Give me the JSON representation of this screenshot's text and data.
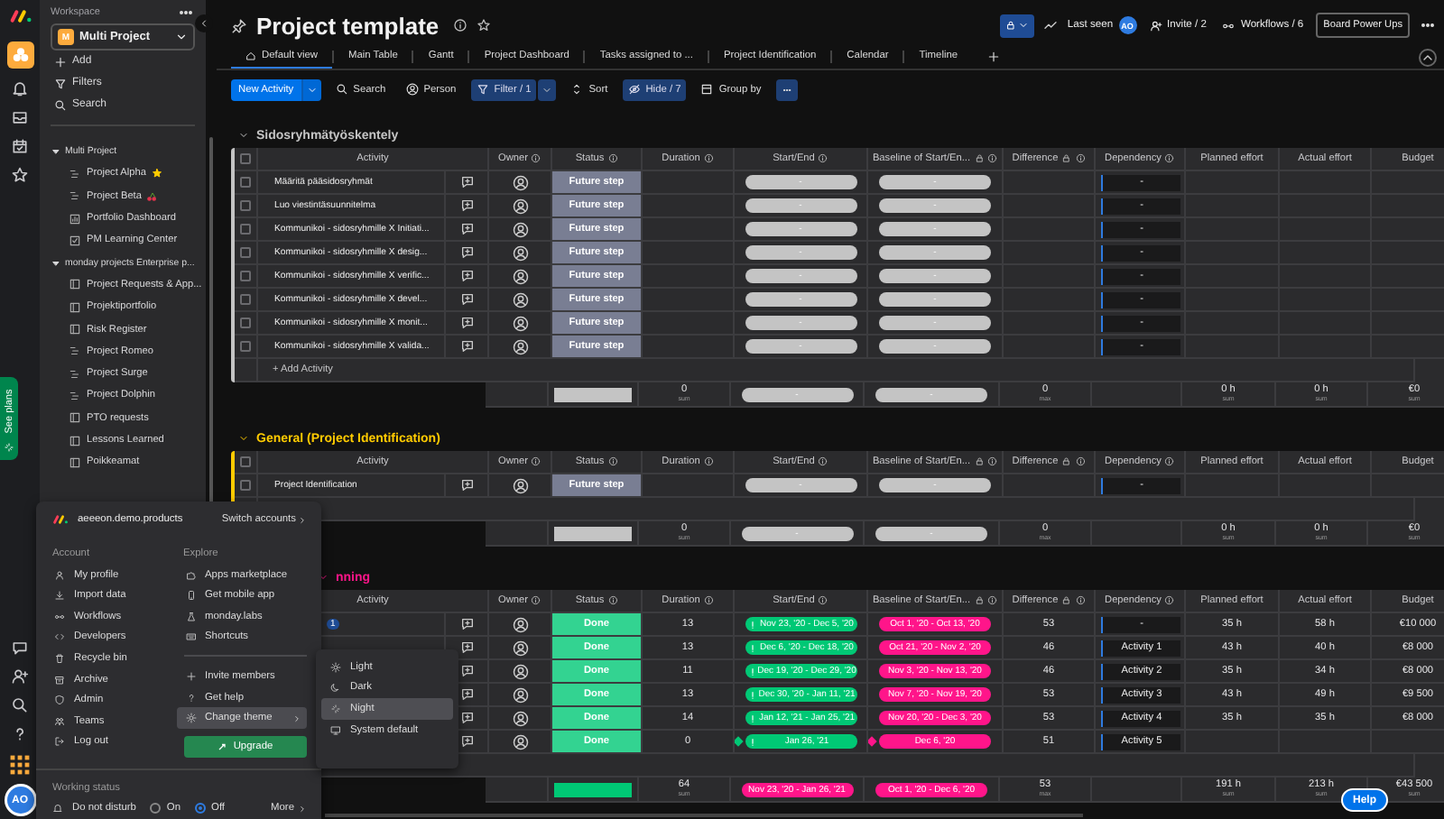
{
  "rail": {
    "user_initials": "AO"
  },
  "sidebar": {
    "workspace_label": "Workspace",
    "workspace_badge": "M",
    "workspace": "Multi Project",
    "actions": [
      "Add",
      "Filters",
      "Search"
    ],
    "tree": [
      {
        "label": "Multi Project",
        "expanded": true,
        "children": [
          {
            "label": "Project Alpha",
            "kind": "gantt",
            "decoration": {
              "kind": "sparkle"
            }
          },
          {
            "label": "Project Beta",
            "kind": "gantt",
            "decoration": {
              "kind": "cherries"
            }
          },
          {
            "label": "Portfolio Dashboard",
            "kind": "dashboard"
          },
          {
            "label": "PM Learning Center",
            "kind": "doc"
          }
        ]
      },
      {
        "label": "monday projects Enterprise p...",
        "expanded": true,
        "children": [
          {
            "label": "Project Requests & App...",
            "kind": "board"
          },
          {
            "label": "Projektiportfolio",
            "kind": "board"
          },
          {
            "label": "Risk Register",
            "kind": "board"
          },
          {
            "label": "Project Romeo",
            "kind": "gantt"
          },
          {
            "label": "Project Surge",
            "kind": "gantt"
          },
          {
            "label": "Project Dolphin",
            "kind": "gantt"
          },
          {
            "label": "PTO requests",
            "kind": "board"
          },
          {
            "label": "Lessons Learned",
            "kind": "board"
          },
          {
            "label": "Poikkeamat",
            "kind": "board"
          }
        ]
      }
    ],
    "see_plans": "See plans"
  },
  "header": {
    "title": "Project template",
    "last_seen": "Last seen",
    "avatar": "AO",
    "invite": "Invite / 2",
    "workflows": "Workflows / 6",
    "power_ups": "Board Power Ups"
  },
  "tabs": [
    {
      "label": "Default view",
      "selected": true
    },
    {
      "label": "Main Table",
      "selected": false
    },
    {
      "label": "Gantt",
      "selected": false
    },
    {
      "label": "Project Dashboard",
      "selected": false
    },
    {
      "label": "Tasks assigned to ...",
      "selected": false
    },
    {
      "label": "Project Identification",
      "selected": false
    },
    {
      "label": "Calendar",
      "selected": false
    },
    {
      "label": "Timeline",
      "selected": false
    }
  ],
  "toolbar": {
    "new_item": "New Activity",
    "search": "Search",
    "person": "Person",
    "filter": "Filter / 1",
    "sort": "Sort",
    "hide": "Hide / 7",
    "group_by": "Group by"
  },
  "groups": [
    {
      "title": "Sidosryhmätyöskentely",
      "color": "#c4c4c4",
      "select_all": false,
      "add_label": "+ Add Activity",
      "columns": [
        {
          "label": "Activity"
        },
        {
          "label": "Owner",
          "info": true
        },
        {
          "label": "Status",
          "info": true
        },
        {
          "label": "Duration",
          "info": true
        },
        {
          "label": "Start/End",
          "info": true
        },
        {
          "label": "Baseline of Start/En...",
          "locked": true,
          "info": true
        },
        {
          "label": "Difference",
          "locked": true,
          "info": true
        },
        {
          "label": "Dependency",
          "info": true
        },
        {
          "label": "Planned effort"
        },
        {
          "label": "Actual effort"
        },
        {
          "label": "Budget"
        }
      ],
      "rows": [
        {
          "name": "Määritä pääsidosryhmät",
          "checked": false,
          "status": {
            "label": "Future step",
            "color": "#797e93"
          },
          "duration": "",
          "start_end": {
            "text": "-",
            "color": "#c4c4c4"
          },
          "baseline": {
            "text": "-",
            "color": "#c4c4c4"
          },
          "difference": "",
          "dependency": "-",
          "planned": "",
          "actual": "",
          "budget": ""
        },
        {
          "name": "Luo viestintäsuunnitelma",
          "checked": false,
          "status": {
            "label": "Future step",
            "color": "#797e93"
          },
          "duration": "",
          "start_end": {
            "text": "-",
            "color": "#c4c4c4"
          },
          "baseline": {
            "text": "-",
            "color": "#c4c4c4"
          },
          "difference": "",
          "dependency": "-",
          "planned": "",
          "actual": "",
          "budget": ""
        },
        {
          "name": "Kommunikoi - sidosryhmille X Initiati...",
          "checked": false,
          "status": {
            "label": "Future step",
            "color": "#797e93"
          },
          "duration": "",
          "start_end": {
            "text": "-",
            "color": "#c4c4c4"
          },
          "baseline": {
            "text": "-",
            "color": "#c4c4c4"
          },
          "difference": "",
          "dependency": "-",
          "planned": "",
          "actual": "",
          "budget": ""
        },
        {
          "name": "Kommunikoi - sidosryhmille X desig...",
          "checked": false,
          "status": {
            "label": "Future step",
            "color": "#797e93"
          },
          "duration": "",
          "start_end": {
            "text": "-",
            "color": "#c4c4c4"
          },
          "baseline": {
            "text": "-",
            "color": "#c4c4c4"
          },
          "difference": "",
          "dependency": "-",
          "planned": "",
          "actual": "",
          "budget": ""
        },
        {
          "name": "Kommunikoi - sidosryhmille X verific...",
          "checked": false,
          "status": {
            "label": "Future step",
            "color": "#797e93"
          },
          "duration": "",
          "start_end": {
            "text": "-",
            "color": "#c4c4c4"
          },
          "baseline": {
            "text": "-",
            "color": "#c4c4c4"
          },
          "difference": "",
          "dependency": "-",
          "planned": "",
          "actual": "",
          "budget": ""
        },
        {
          "name": "Kommunikoi - sidosryhmille X devel...",
          "checked": false,
          "status": {
            "label": "Future step",
            "color": "#797e93"
          },
          "duration": "",
          "start_end": {
            "text": "-",
            "color": "#c4c4c4"
          },
          "baseline": {
            "text": "-",
            "color": "#c4c4c4"
          },
          "difference": "",
          "dependency": "-",
          "planned": "",
          "actual": "",
          "budget": ""
        },
        {
          "name": "Kommunikoi - sidosryhmille X monit...",
          "checked": false,
          "status": {
            "label": "Future step",
            "color": "#797e93"
          },
          "duration": "",
          "start_end": {
            "text": "-",
            "color": "#c4c4c4"
          },
          "baseline": {
            "text": "-",
            "color": "#c4c4c4"
          },
          "difference": "",
          "dependency": "-",
          "planned": "",
          "actual": "",
          "budget": ""
        },
        {
          "name": "Kommunikoi - sidosryhmille X valida...",
          "checked": false,
          "status": {
            "label": "Future step",
            "color": "#797e93"
          },
          "duration": "",
          "start_end": {
            "text": "-",
            "color": "#c4c4c4"
          },
          "baseline": {
            "text": "-",
            "color": "#c4c4c4"
          },
          "difference": "",
          "dependency": "-",
          "planned": "",
          "actual": "",
          "budget": ""
        }
      ],
      "summary": {
        "status_bar": {
          "color": "#c4c4c4"
        },
        "duration": "0",
        "duration_fn": "sum",
        "start_end": {
          "text": "-",
          "color": "#c4c4c4"
        },
        "baseline": {
          "text": "-",
          "color": "#c4c4c4"
        },
        "difference": "0",
        "difference_fn": "max",
        "planned": "0 h",
        "planned_fn": "sum",
        "actual": "0 h",
        "actual_fn": "sum",
        "budget": "€0",
        "budget_fn": "sum"
      }
    },
    {
      "title": "General (Project Identification)",
      "color": "#ffcb00",
      "select_all": false,
      "columns": [
        {
          "label": "Activity"
        },
        {
          "label": "Owner",
          "info": true
        },
        {
          "label": "Status",
          "info": true
        },
        {
          "label": "Duration",
          "info": true
        },
        {
          "label": "Start/End",
          "info": true
        },
        {
          "label": "Baseline of Start/En...",
          "locked": true,
          "info": true
        },
        {
          "label": "Difference",
          "locked": true,
          "info": true
        },
        {
          "label": "Dependency",
          "info": true
        },
        {
          "label": "Planned effort"
        },
        {
          "label": "Actual effort"
        },
        {
          "label": "Budget"
        }
      ],
      "rows": [
        {
          "name": "Project Identification",
          "checked": false,
          "status": {
            "label": "Future step",
            "color": "#797e93"
          },
          "duration": "",
          "start_end": {
            "text": "-",
            "color": "#c4c4c4"
          },
          "baseline": {
            "text": "-",
            "color": "#c4c4c4"
          },
          "difference": "",
          "dependency": "-",
          "planned": "",
          "actual": "",
          "budget": ""
        }
      ],
      "summary": {
        "status_bar": {
          "color": "#c4c4c4"
        },
        "duration": "0",
        "duration_fn": "sum",
        "start_end": {
          "text": "-",
          "color": "#c4c4c4"
        },
        "baseline": {
          "text": "-",
          "color": "#c4c4c4"
        },
        "difference": "0",
        "difference_fn": "max",
        "planned": "0 h",
        "planned_fn": "sum",
        "actual": "0 h",
        "actual_fn": "sum",
        "budget": "€0",
        "budget_fn": "sum"
      }
    },
    {
      "title": "nning",
      "color": "#ff158a",
      "columns": [
        {
          "label": "Activity"
        },
        {
          "label": "Owner",
          "info": true
        },
        {
          "label": "Status",
          "info": true
        },
        {
          "label": "Duration",
          "info": true
        },
        {
          "label": "Start/End",
          "info": true
        },
        {
          "label": "Baseline of Start/En...",
          "locked": true,
          "info": true
        },
        {
          "label": "Difference",
          "locked": true,
          "info": true
        },
        {
          "label": "Dependency",
          "info": true
        },
        {
          "label": "Planned effort"
        },
        {
          "label": "Actual effort"
        },
        {
          "label": "Budget"
        }
      ],
      "rows": [
        {
          "badge": "1",
          "status": {
            "label": "Done",
            "color": "#33d391"
          },
          "duration": "13",
          "start_end": {
            "text": "Nov 23, '20 - Dec 5, '20",
            "color": "#00c875",
            "alert": true
          },
          "baseline": {
            "text": "Oct 1, '20 - Oct 13, '20",
            "color": "#ff158a"
          },
          "difference": "53",
          "dependency": "-",
          "planned": "35 h",
          "actual": "58 h",
          "budget": "€10 000"
        },
        {
          "status": {
            "label": "Done",
            "color": "#33d391"
          },
          "duration": "13",
          "start_end": {
            "text": "Dec 6, '20 - Dec 18, '20",
            "color": "#00c875",
            "alert": true
          },
          "baseline": {
            "text": "Oct 21, '20 - Nov 2, '20",
            "color": "#ff158a"
          },
          "difference": "46",
          "dependency": "Activity 1",
          "planned": "43 h",
          "actual": "40 h",
          "budget": "€8 000"
        },
        {
          "status": {
            "label": "Done",
            "color": "#33d391"
          },
          "duration": "11",
          "start_end": {
            "text": "Dec 19, '20 - Dec 29, '20",
            "color": "#00c875",
            "alert": true
          },
          "baseline": {
            "text": "Nov 3, '20 - Nov 13, '20",
            "color": "#ff158a"
          },
          "difference": "46",
          "dependency": "Activity 2",
          "planned": "35 h",
          "actual": "34 h",
          "budget": "€8 000"
        },
        {
          "status": {
            "label": "Done",
            "color": "#33d391"
          },
          "duration": "13",
          "start_end": {
            "text": "Dec 30, '20 - Jan 11, '21",
            "color": "#00c875",
            "alert": true
          },
          "baseline": {
            "text": "Nov 7, '20 - Nov 19, '20",
            "color": "#ff158a"
          },
          "difference": "53",
          "dependency": "Activity 3",
          "planned": "43 h",
          "actual": "49 h",
          "budget": "€9 500"
        },
        {
          "status": {
            "label": "Done",
            "color": "#33d391"
          },
          "duration": "14",
          "start_end": {
            "text": "Jan 12, '21 - Jan 25, '21",
            "color": "#00c875",
            "alert": true
          },
          "baseline": {
            "text": "Nov 20, '20 - Dec 3, '20",
            "color": "#ff158a"
          },
          "difference": "53",
          "dependency": "Activity 4",
          "planned": "35 h",
          "actual": "35 h",
          "budget": "€8 000"
        },
        {
          "milestone": true,
          "status": {
            "label": "Done",
            "color": "#33d391"
          },
          "duration": "0",
          "start_end": {
            "text": "Jan 26, '21",
            "color": "#00c875",
            "alert": true
          },
          "baseline": {
            "text": "Dec 6, '20",
            "color": "#ff158a"
          },
          "difference": "51",
          "dependency": "Activity 5",
          "planned": "",
          "actual": "",
          "budget": ""
        }
      ],
      "summary": {
        "status_bar": {
          "color": "#00c875"
        },
        "duration": "64",
        "duration_fn": "sum",
        "start_end": {
          "text": "Nov 23, '20 - Jan 26, '21",
          "color": "#ff158a"
        },
        "baseline": {
          "text": "Oct 1, '20 - Dec 6, '20",
          "color": "#ff158a"
        },
        "difference": "53",
        "difference_fn": "max",
        "planned": "191 h",
        "planned_fn": "sum",
        "actual": "213 h",
        "actual_fn": "sum",
        "budget": "€43 500",
        "budget_fn": "sum"
      }
    }
  ],
  "account_menu": {
    "account": "aeeeon.demo.products",
    "switch": "Switch accounts",
    "sections": [
      {
        "title": "Account",
        "items": [
          {
            "label": "My profile",
            "kind": "item"
          },
          {
            "label": "Import data",
            "kind": "item"
          },
          {
            "label": "Workflows",
            "kind": "item"
          },
          {
            "label": "Developers",
            "kind": "item"
          },
          {
            "label": "Recycle bin",
            "kind": "item"
          },
          {
            "label": "Archive",
            "kind": "item"
          },
          {
            "label": "Admin",
            "kind": "item"
          },
          {
            "label": "Teams",
            "kind": "item"
          },
          {
            "label": "Log out",
            "kind": "item"
          }
        ]
      },
      {
        "title": "Explore",
        "items": [
          {
            "label": "Apps marketplace",
            "kind": "item"
          },
          {
            "label": "Get mobile app",
            "kind": "item"
          },
          {
            "label": "monday.labs",
            "kind": "item"
          },
          {
            "label": "Shortcuts",
            "kind": "item"
          },
          {
            "kind": "divider"
          },
          {
            "label": "Invite members",
            "kind": "item"
          },
          {
            "label": "Get help",
            "kind": "item"
          },
          {
            "label": "Change theme",
            "kind": "submenu",
            "highlighted": true
          }
        ]
      }
    ],
    "upgrade": "Upgrade",
    "working_status": "Working status",
    "dnd": "Do not disturb",
    "options": [
      {
        "label": "On",
        "selected": false
      },
      {
        "label": "Off",
        "selected": true
      }
    ],
    "more": "More"
  },
  "theme_menu": [
    {
      "label": "Light",
      "selected": false
    },
    {
      "label": "Dark",
      "selected": false
    },
    {
      "label": "Night",
      "selected": true
    },
    {
      "label": "System default",
      "selected": false
    }
  ],
  "help": "Help"
}
